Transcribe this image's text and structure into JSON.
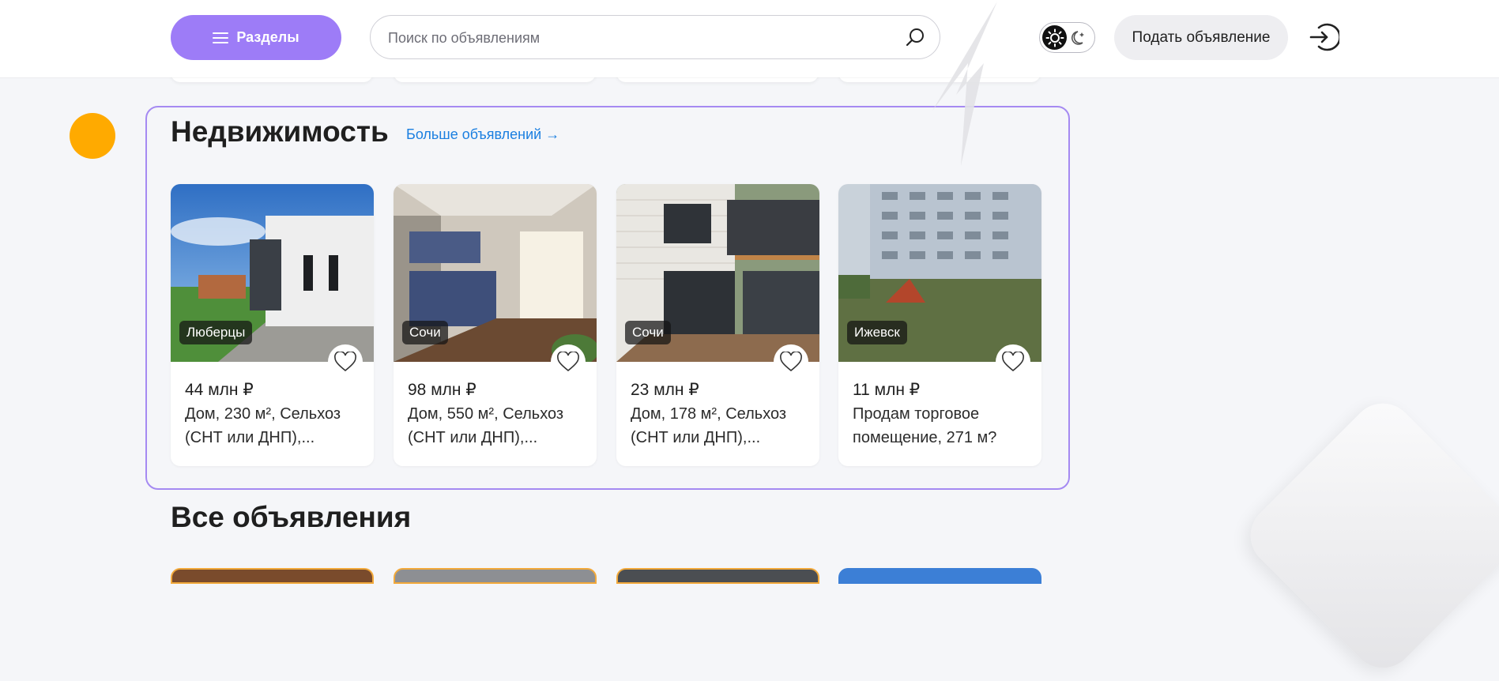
{
  "header": {
    "sections_label": "Разделы",
    "search_placeholder": "Поиск по объявлениям",
    "post_ad_label": "Подать объявление"
  },
  "real_estate": {
    "title": "Недвижимость",
    "more_link": "Больше объявлений →",
    "cards": [
      {
        "city": "Люберцы",
        "price": "44 млн ₽",
        "description": "Дом, 230 м², Сельхоз (СНТ или ДНП),..."
      },
      {
        "city": "Сочи",
        "price": "98 млн ₽",
        "description": "Дом, 550 м², Сельхоз (СНТ или ДНП),..."
      },
      {
        "city": "Сочи",
        "price": "23 млн ₽",
        "description": "Дом, 178 м², Сельхоз (СНТ или ДНП),..."
      },
      {
        "city": "Ижевск",
        "price": "11 млн ₽",
        "description": "Продам торговое помещение, 271 м?"
      }
    ]
  },
  "all_ads": {
    "title": "Все объявления"
  },
  "colors": {
    "accent": "#9d7cf7",
    "link": "#1b7fe0",
    "dot": "#ffaa00"
  },
  "icons": [
    "menu-icon",
    "search-icon",
    "sun-icon",
    "moon-icon",
    "login-icon",
    "heart-icon"
  ]
}
